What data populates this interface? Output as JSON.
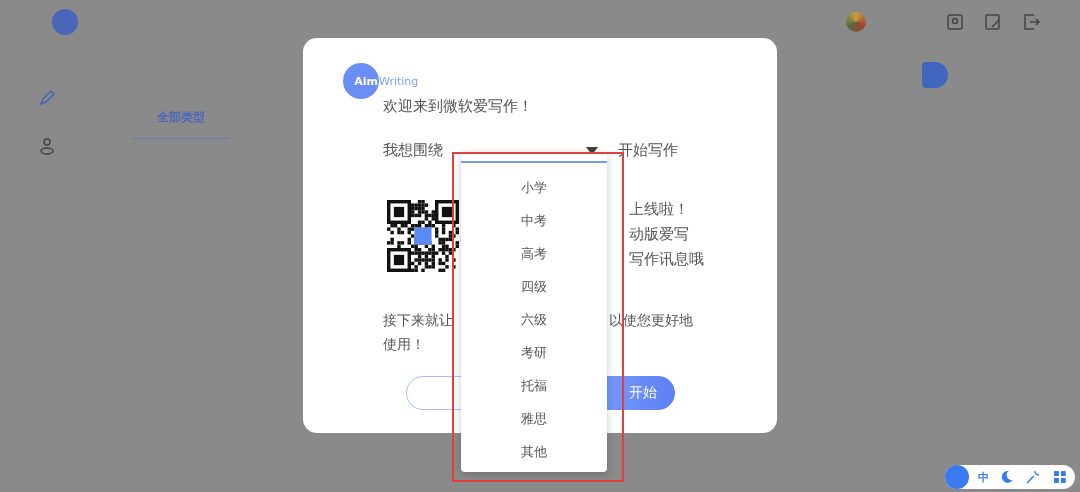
{
  "app": {
    "nav_tab": "全部类型"
  },
  "dialog": {
    "logo": {
      "mark": "Aim",
      "word": "Writing"
    },
    "welcome": "欢迎来到微软爱写作！",
    "topic_select": {
      "label": "我想围绕",
      "suffix": "开始写作"
    },
    "promo_lines": [
      "上线啦！",
      "动版爱写",
      "写作讯息哦"
    ],
    "intro_parts": [
      "接下来就让",
      "以使您更好地",
      "使用！"
    ],
    "start_button": "开始"
  },
  "dropdown": {
    "options": [
      "小学",
      "中考",
      "高考",
      "四级",
      "六级",
      "考研",
      "托福",
      "雅思",
      "其他"
    ]
  },
  "ime_toolbar": {
    "mode": "中"
  }
}
